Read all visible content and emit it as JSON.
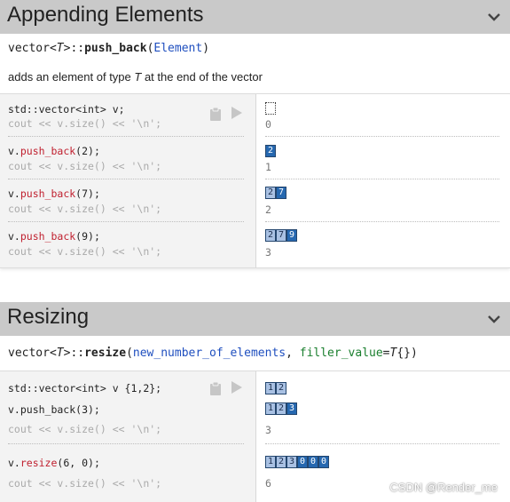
{
  "sections": {
    "append": {
      "title": "Appending Elements",
      "signature": {
        "prefix": "vector<",
        "tparam": "T",
        "mid": ">::",
        "name": "push_back",
        "open": "(",
        "param": "Element",
        "close": ")"
      },
      "description": {
        "pre": "adds an element of type ",
        "tparam": "T",
        "post": " at the end of the vector"
      },
      "rows": [
        {
          "code1": "std::vector<int> v;",
          "code2": "cout << v.size() << '\\n';",
          "output": "0"
        },
        {
          "code1_obj": "v.",
          "code1_call": "push_back",
          "code1_args": "(2);",
          "code2": "cout << v.size() << '\\n';",
          "output": "1"
        },
        {
          "code1_obj": "v.",
          "code1_call": "push_back",
          "code1_args": "(7);",
          "code2": "cout << v.size() << '\\n';",
          "output": "2"
        },
        {
          "code1_obj": "v.",
          "code1_call": "push_back",
          "code1_args": "(9);",
          "code2": "cout << v.size() << '\\n';",
          "output": "3"
        }
      ],
      "vectors": [
        [],
        [
          {
            "v": "2",
            "state": "new"
          }
        ],
        [
          {
            "v": "2",
            "state": "old"
          },
          {
            "v": "7",
            "state": "new"
          }
        ],
        [
          {
            "v": "2",
            "state": "old"
          },
          {
            "v": "7",
            "state": "old"
          },
          {
            "v": "9",
            "state": "new"
          }
        ]
      ]
    },
    "resize": {
      "title": "Resizing",
      "signature": {
        "prefix": "vector<",
        "tparam": "T",
        "mid": ">::",
        "name": "resize",
        "open": "(",
        "param1": "new_number_of_elements",
        "comma": ", ",
        "param2": "filler_value",
        "eq": "=",
        "default_t": "T",
        "default_rest": "{})"
      },
      "lines": {
        "init": "std::vector<int> v {1,2};",
        "push": "v.push_back(3);",
        "size1": "cout << v.size() << '\\n';",
        "resize_obj": "v.",
        "resize_call": "resize",
        "resize_args": "(6, 0);",
        "size2": "cout << v.size() << '\\n';"
      },
      "outputs": {
        "size1": "3",
        "size2": "6"
      },
      "vectors": {
        "init": [
          {
            "v": "1",
            "state": "old"
          },
          {
            "v": "2",
            "state": "old"
          }
        ],
        "push": [
          {
            "v": "1",
            "state": "old"
          },
          {
            "v": "2",
            "state": "old"
          },
          {
            "v": "3",
            "state": "new"
          }
        ],
        "resize": [
          {
            "v": "1",
            "state": "old"
          },
          {
            "v": "2",
            "state": "old"
          },
          {
            "v": "3",
            "state": "old"
          },
          {
            "v": "0",
            "state": "new"
          },
          {
            "v": "0",
            "state": "new"
          },
          {
            "v": "0",
            "state": "new"
          }
        ]
      }
    }
  },
  "icons": {
    "clipboard": "clipboard-icon",
    "run": "play-icon",
    "collapse": "chevron-down-icon"
  },
  "watermark": "CSDN @Render_me",
  "colors": {
    "header_bg": "#c9c9c9",
    "code_bg": "#f3f3f3",
    "cell_new": "#2668b0",
    "cell_old": "#a9c1e3",
    "call_red": "#c0202f",
    "type_blue": "#1f4fbf",
    "param_green": "#1a7f2e"
  }
}
